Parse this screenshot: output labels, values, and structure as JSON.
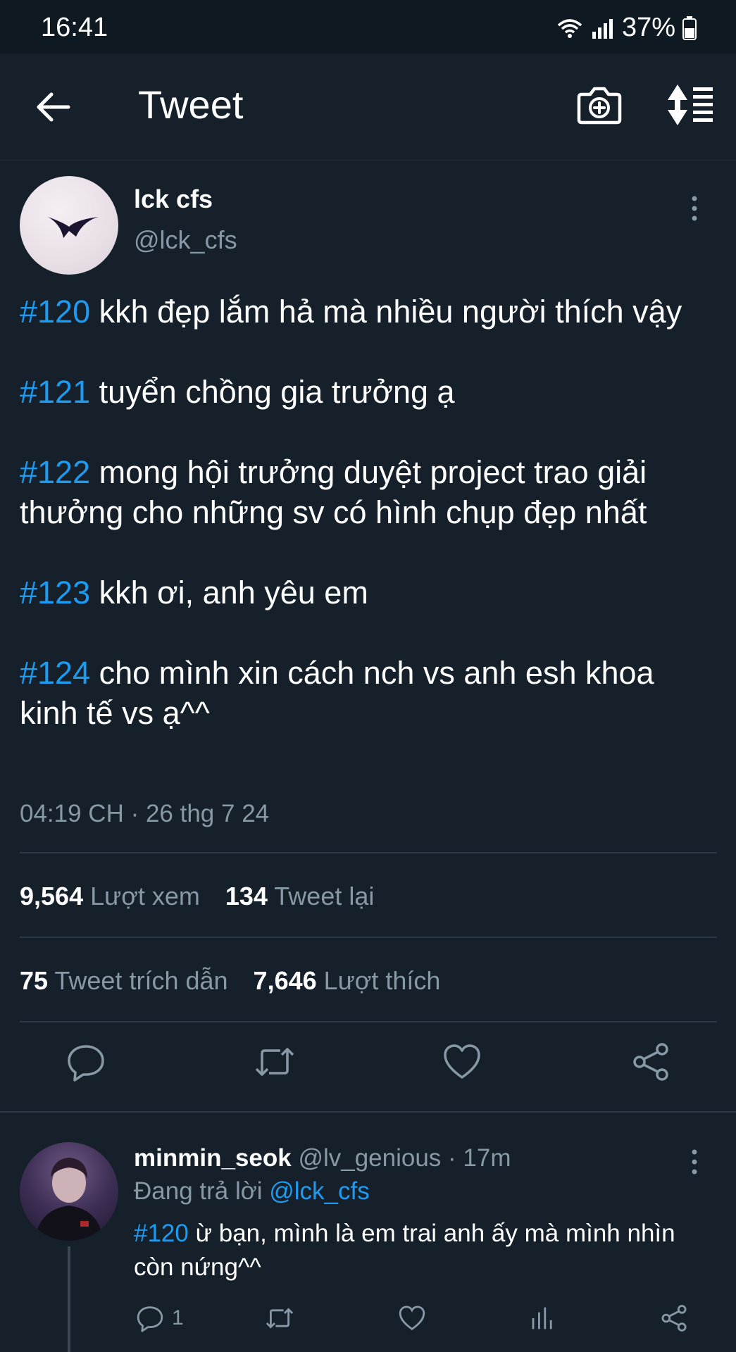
{
  "status_bar": {
    "time": "16:41",
    "battery": "37%"
  },
  "header": {
    "title": "Tweet"
  },
  "tweet": {
    "author_name": "lck cfs",
    "author_handle": "@lck_cfs",
    "paragraphs": [
      {
        "tag": "#120",
        "text": " kkh đẹp lắm hả mà nhiều người thích vậy"
      },
      {
        "tag": "#121",
        "text": " tuyển chồng gia trưởng ạ"
      },
      {
        "tag": "#122",
        "text": " mong hội trưởng duyệt project trao giải thưởng cho những sv có hình chụp đẹp nhất"
      },
      {
        "tag": "#123",
        "text": " kkh ơi, anh yêu em"
      },
      {
        "tag": "#124",
        "text": " cho mình xin cách nch vs anh esh khoa kinh tế vs ạ^^"
      }
    ],
    "timestamp": "04:19 CH · 26 thg 7 24",
    "views_count": "9,564",
    "views_label": "Lượt xem",
    "retweets_count": "134",
    "retweets_label": "Tweet lại",
    "quotes_count": "75",
    "quotes_label": "Tweet trích dẫn",
    "likes_count": "7,646",
    "likes_label": "Lượt thích"
  },
  "reply": {
    "name": "minmin_seok",
    "handle": "@lv_genious",
    "separator": " · ",
    "time": "17m",
    "replying_prefix": "Đang trả lời ",
    "replying_to": "@lck_cfs",
    "tag": "#120",
    "text": " ừ bạn, mình là em trai anh ấy mà mình nhìn còn nứng^^",
    "reply_count": "1"
  },
  "colors": {
    "background": "#15202b",
    "accent": "#1d9bf0",
    "muted": "#8899a6"
  }
}
